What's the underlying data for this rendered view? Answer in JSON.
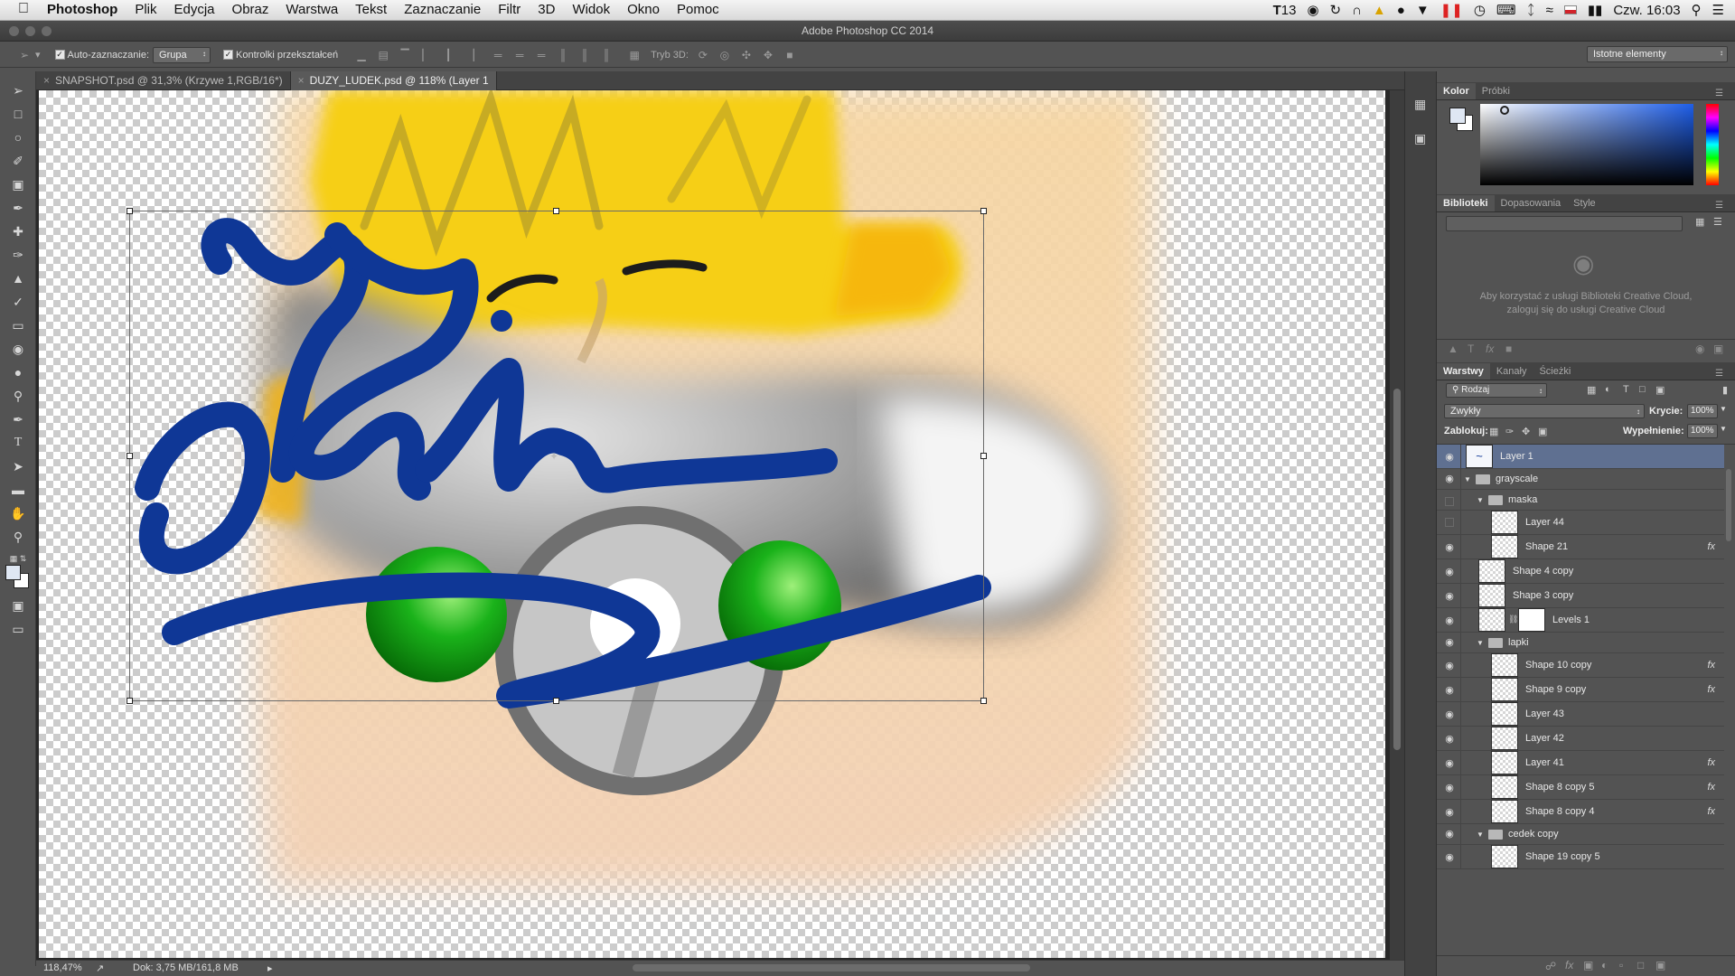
{
  "menubar": {
    "apple": "",
    "app": "Photoshop",
    "items": [
      "Plik",
      "Edycja",
      "Obraz",
      "Warstwa",
      "Tekst",
      "Zaznaczanie",
      "Filtr",
      "3D",
      "Widok",
      "Okno",
      "Pomoc"
    ],
    "status_badge": "13",
    "clock": "Czw. 16:03"
  },
  "window": {
    "title": "Adobe Photoshop CC 2014"
  },
  "options": {
    "auto_select_label": "Auto-zaznaczanie:",
    "auto_select_value": "Grupa",
    "transform_label": "Kontrolki przekształceń",
    "mode3d_label": "Tryb 3D:",
    "workspace": "Istotne elementy"
  },
  "tabs": [
    {
      "label": "SNAPSHOT.psd @ 31,3% (Krzywe 1,RGB/16*)"
    },
    {
      "label": "DUZY_LUDEK.psd @ 118% (Layer 1"
    }
  ],
  "status": {
    "zoom": "118,47%",
    "doc": "Dok: 3,75 MB/161,8 MB"
  },
  "color_panel": {
    "tabs": [
      "Kolor",
      "Próbki"
    ]
  },
  "libraries_panel": {
    "tabs": [
      "Biblioteki",
      "Dopasowania",
      "Style"
    ],
    "message": "Aby korzystać z usługi Biblioteki Creative Cloud, zaloguj się do usługi Creative Cloud"
  },
  "layers_panel": {
    "tabs": [
      "Warstwy",
      "Kanały",
      "Ścieżki"
    ],
    "filter": "Rodzaj",
    "blend_mode": "Zwykły",
    "opacity_label": "Krycie:",
    "opacity": "100%",
    "lock_label": "Zablokuj:",
    "fill_label": "Wypełnienie:",
    "fill": "100%",
    "layers": [
      {
        "name": "Layer 1",
        "type": "layer",
        "indent": 0,
        "visible": true,
        "fx": false,
        "selected": true
      },
      {
        "name": "grayscale",
        "type": "group",
        "indent": 0,
        "visible": true,
        "fx": false
      },
      {
        "name": "maska",
        "type": "group",
        "indent": 1,
        "visible": false,
        "fx": false
      },
      {
        "name": "Layer 44",
        "type": "layer",
        "indent": 2,
        "visible": false,
        "fx": false
      },
      {
        "name": "Shape 21",
        "type": "layer",
        "indent": 2,
        "visible": true,
        "fx": true
      },
      {
        "name": "Shape 4 copy",
        "type": "layer",
        "indent": 1,
        "visible": true,
        "fx": false
      },
      {
        "name": "Shape 3 copy",
        "type": "layer",
        "indent": 1,
        "visible": true,
        "fx": false
      },
      {
        "name": "Levels 1",
        "type": "adjustment",
        "indent": 1,
        "visible": true,
        "fx": false
      },
      {
        "name": "lapki",
        "type": "group",
        "indent": 1,
        "visible": true,
        "fx": false
      },
      {
        "name": "Shape 10 copy",
        "type": "layer",
        "indent": 2,
        "visible": true,
        "fx": true
      },
      {
        "name": "Shape 9 copy",
        "type": "layer",
        "indent": 2,
        "visible": true,
        "fx": true
      },
      {
        "name": "Layer 43",
        "type": "layer",
        "indent": 2,
        "visible": true,
        "fx": false
      },
      {
        "name": "Layer 42",
        "type": "layer",
        "indent": 2,
        "visible": true,
        "fx": false
      },
      {
        "name": "Layer 41",
        "type": "layer",
        "indent": 2,
        "visible": true,
        "fx": true
      },
      {
        "name": "Shape 8 copy 5",
        "type": "layer",
        "indent": 2,
        "visible": true,
        "fx": true
      },
      {
        "name": "Shape 8 copy 4",
        "type": "layer",
        "indent": 2,
        "visible": true,
        "fx": true
      },
      {
        "name": "cedek copy",
        "type": "group",
        "indent": 1,
        "visible": true,
        "fx": false
      },
      {
        "name": "Shape 19 copy 5",
        "type": "layer",
        "indent": 2,
        "visible": true,
        "fx": false
      }
    ]
  },
  "colors": {
    "selection": "#5f7091",
    "brush_stroke": "#0f3796",
    "fg_swatch": "#dfe7f3"
  },
  "icons": [
    "apple-icon",
    "move-tool-icon",
    "marquee-tool-icon",
    "lasso-tool-icon",
    "brush-tool-icon",
    "eye-icon",
    "folder-icon",
    "fx-icon"
  ]
}
